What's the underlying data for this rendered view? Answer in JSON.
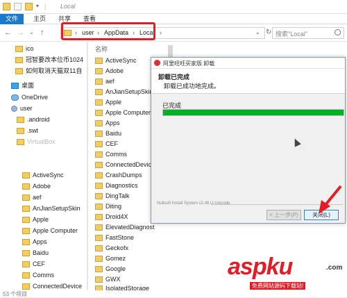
{
  "window": {
    "title": "Local"
  },
  "ribbon_tabs": [
    "文件",
    "主页",
    "共享",
    "查看"
  ],
  "address": {
    "crumbs": [
      "user",
      "AppData",
      "Local"
    ],
    "search_placeholder": "搜索\"Local\""
  },
  "nav_items": [
    {
      "label": "ico",
      "icon": "folder-icon"
    },
    {
      "label": "冠智要改本位币1024",
      "icon": "folder-icon"
    },
    {
      "label": "如何取消天猫双11自",
      "icon": "folder-icon"
    },
    {
      "label": "桌面",
      "icon": "desktop-icon"
    },
    {
      "label": "OneDrive",
      "icon": "onedrive-icon"
    },
    {
      "label": "user",
      "icon": "user-icon"
    },
    {
      "label": ".android",
      "icon": "folder-icon"
    },
    {
      "label": ".swt",
      "icon": "folder-icon"
    },
    {
      "label": "VirtualBox",
      "icon": "folder-icon"
    },
    {
      "label": "ActiveSync",
      "icon": "folder-icon"
    },
    {
      "label": "Adobe",
      "icon": "folder-icon"
    },
    {
      "label": "aef",
      "icon": "folder-icon"
    },
    {
      "label": "AnJianSetupSkin",
      "icon": "folder-icon"
    },
    {
      "label": "Apple",
      "icon": "folder-icon"
    },
    {
      "label": "Apple Computer",
      "icon": "folder-icon"
    },
    {
      "label": "Apps",
      "icon": "folder-icon"
    },
    {
      "label": "Baidu",
      "icon": "folder-icon"
    },
    {
      "label": "CEF",
      "icon": "folder-icon"
    },
    {
      "label": "Comms",
      "icon": "folder-icon"
    },
    {
      "label": "ConnectedDevice",
      "icon": "folder-icon"
    }
  ],
  "file_pane": {
    "column_header": "名称",
    "items": [
      "ActiveSync",
      "Adobe",
      "aef",
      "AnJianSetupSkin",
      "Apple",
      "Apple Computer",
      "Apps",
      "Baidu",
      "CEF",
      "Comms",
      "ConnectedDevice",
      "CrashDumps",
      "Diagnostics",
      "DingTalk",
      "Diting",
      "Droid4X",
      "ElevatedDiagnost",
      "FastStone",
      "Geckofx",
      "Gomez",
      "Google",
      "GWX",
      "IsolatedStorage"
    ]
  },
  "status_bar": {
    "text": "53 个项目"
  },
  "dialog": {
    "title": "阿里旺旺买家版 卸载",
    "header": "卸载已完成",
    "subheader": "卸载已成功地完成。",
    "progress_label": "已完成",
    "progress": 1.0,
    "brand": "Nullsoft Install System v2.46 U-Unicode",
    "prev_button": "< 上一步(P)",
    "close_button": "关闭(L)"
  },
  "watermark": {
    "main_a": "asp",
    "main_b": "ku",
    "suffix": ".com",
    "sub": "免费网站源码下载站!"
  },
  "colors": {
    "highlight": "#e31d25",
    "progress": "#06b025",
    "folder": "#f3cd62",
    "accent": "#1979ca"
  }
}
